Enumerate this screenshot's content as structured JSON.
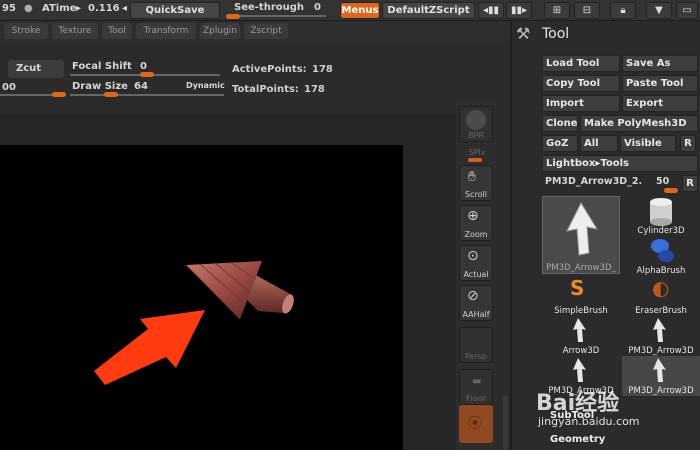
{
  "topbar": {
    "counter": "95",
    "atime_label": "ATime",
    "atime_value": "0.116",
    "quicksave_label": "QuickSave",
    "seethrough_label": "See-through",
    "seethrough_value": "0",
    "menus_label": "Menus",
    "script_label": "DefaultZScript"
  },
  "tabs": [
    "Stroke",
    "Texture",
    "Tool",
    "Transform",
    "Zplugin",
    "Zscript"
  ],
  "controls": {
    "zcut_label": "Zcut",
    "focal_label": "Focal Shift",
    "focal_value": "0",
    "draw_label": "Draw Size",
    "draw_value": "64",
    "dynamic_label": "Dynamic",
    "left_value": "00",
    "active_label": "ActivePoints:",
    "active_value": "178",
    "total_label": "TotalPoints:",
    "total_value": "178"
  },
  "shelf": {
    "bpr": "BPR",
    "spix": "SPix",
    "scroll": "Scroll",
    "zoom": "Zoom",
    "actual": "Actual",
    "aahalf": "AAHalf",
    "persp": "Persp",
    "floor": "Floor"
  },
  "palette": {
    "title": "Tool",
    "buttons": {
      "load": "Load Tool",
      "save": "Save As",
      "copy": "Copy Tool",
      "paste": "Paste Tool",
      "import": "Import",
      "export": "Export",
      "clone": "Clone",
      "polymesh": "Make PolyMesh3D",
      "goz": "GoZ",
      "all": "All",
      "visible": "Visible",
      "r": "R",
      "lightbox": "Lightbox▸Tools",
      "current_tool": "PM3D_Arrow3D_2.",
      "current_value": "50",
      "r2": "R"
    },
    "thumbs": [
      "PM3D_Arrow3D_",
      "Cylinder3D",
      "AlphaBrush",
      "SimpleBrush",
      "EraserBrush",
      "Arrow3D",
      "PM3D_Arrow3D",
      "PM3D_Arrow3D",
      "PM3D_Arrow3D"
    ],
    "subtool": "SubTool",
    "geometry": "Geometry"
  },
  "watermark": {
    "brand": "Bai经验",
    "url": "jingyan.baidu.com"
  },
  "colors": {
    "accent": "#e0661a",
    "arrow_annotation": "#ff3b10",
    "model": "#9a4a42"
  }
}
